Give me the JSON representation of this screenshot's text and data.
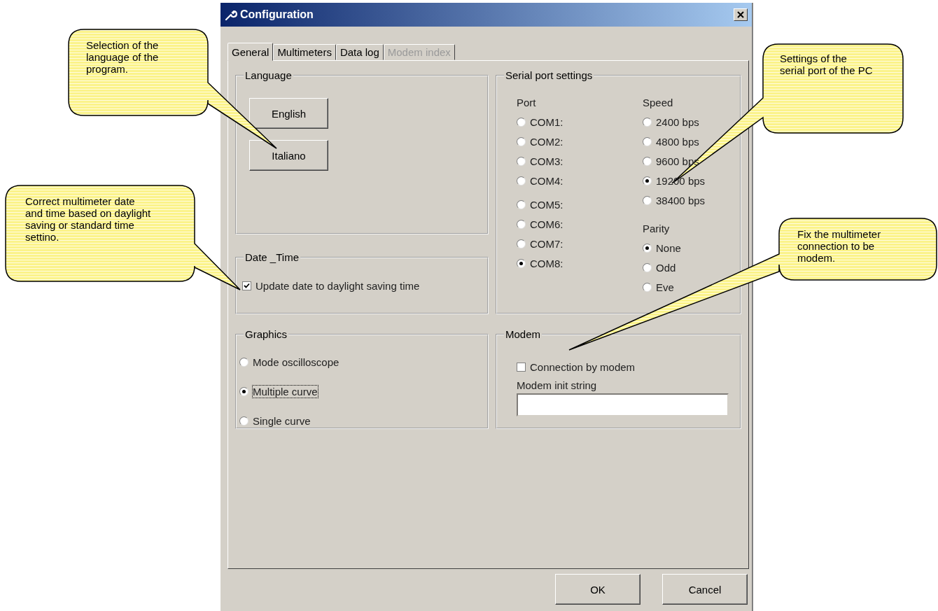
{
  "window": {
    "title": "Configuration"
  },
  "tabs": [
    {
      "label": "General",
      "selected": true,
      "disabled": false
    },
    {
      "label": "Multimeters",
      "selected": false,
      "disabled": false
    },
    {
      "label": "Data log",
      "selected": false,
      "disabled": false
    },
    {
      "label": "Modem index",
      "selected": false,
      "disabled": true
    }
  ],
  "language": {
    "title": "Language",
    "buttons": [
      "English",
      "Italiano"
    ]
  },
  "date_time": {
    "title": "Date _Time",
    "checkbox": {
      "label": "Update date to daylight saving time",
      "checked": true
    }
  },
  "graphics": {
    "title": "Graphics",
    "options": [
      {
        "label": "Mode oscilloscope",
        "selected": false,
        "focused": false
      },
      {
        "label": "Multiple curve",
        "selected": true,
        "focused": true
      },
      {
        "label": "Single curve",
        "selected": false,
        "focused": false
      }
    ]
  },
  "serial_port": {
    "title": "Serial port settings",
    "port_label": "Port",
    "ports": [
      {
        "label": "COM1:",
        "selected": false
      },
      {
        "label": "COM2:",
        "selected": false
      },
      {
        "label": "COM3:",
        "selected": false
      },
      {
        "label": "COM4:",
        "selected": false
      },
      {
        "label": "COM5:",
        "selected": false
      },
      {
        "label": "COM6:",
        "selected": false
      },
      {
        "label": "COM7:",
        "selected": false
      },
      {
        "label": "COM8:",
        "selected": true
      }
    ],
    "speed_label": "Speed",
    "speeds": [
      {
        "label": "2400 bps",
        "selected": false
      },
      {
        "label": "4800 bps",
        "selected": false
      },
      {
        "label": "9600 bps",
        "selected": false
      },
      {
        "label": "19200 bps",
        "selected": true
      },
      {
        "label": "38400 bps",
        "selected": false
      }
    ],
    "parity_label": "Parity",
    "parities": [
      {
        "label": "None",
        "selected": true
      },
      {
        "label": "Odd",
        "selected": false
      },
      {
        "label": "Eve",
        "selected": false
      }
    ]
  },
  "modem": {
    "title": "Modem",
    "checkbox": {
      "label": "Connection by modem",
      "checked": false
    },
    "init_label": "Modem init string"
  },
  "buttons": [
    "OK",
    "Cancel"
  ],
  "callouts": [
    "Selection of the language of the program.",
    "Correct multimeter date and time based on daylight saving or standard time settino.",
    "Settings of the serial port of the PC",
    "Fix the multimeter connection to be modem."
  ]
}
